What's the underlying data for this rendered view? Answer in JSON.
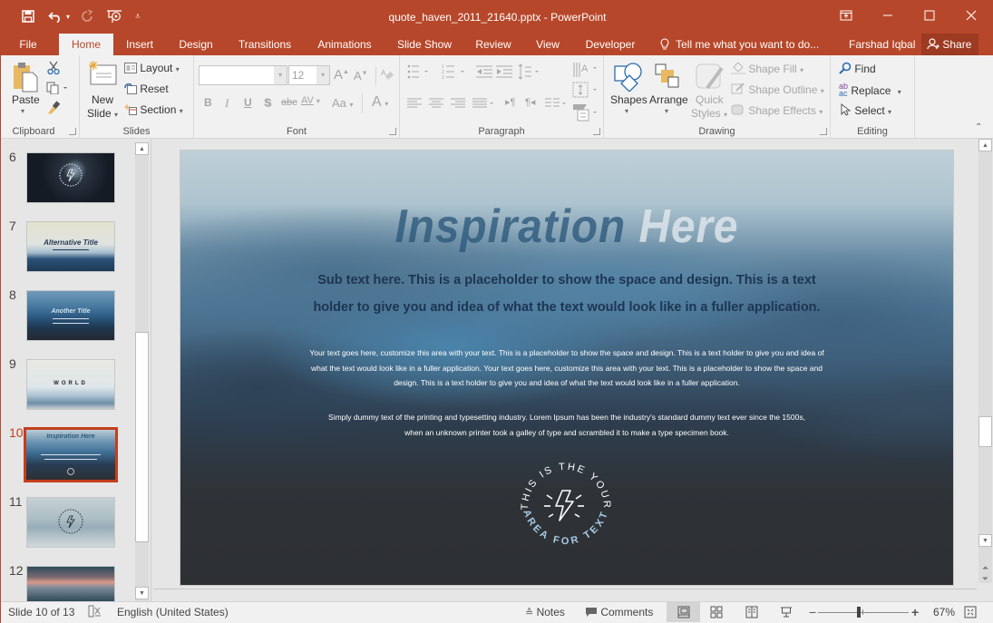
{
  "window": {
    "title": "quote_haven_2011_21640.pptx - PowerPoint",
    "controls": [
      "ribbon-display-options",
      "minimize",
      "maximize",
      "close"
    ]
  },
  "qat": {
    "icons": [
      "save-icon",
      "undo-icon",
      "undo-dropdown-icon",
      "redo-icon",
      "start-from-beginning-icon",
      "customize-qat-icon"
    ]
  },
  "tabs": [
    {
      "label": "File"
    },
    {
      "label": "Home",
      "active": true
    },
    {
      "label": "Insert"
    },
    {
      "label": "Design"
    },
    {
      "label": "Transitions"
    },
    {
      "label": "Animations"
    },
    {
      "label": "Slide Show"
    },
    {
      "label": "Review"
    },
    {
      "label": "View"
    },
    {
      "label": "Developer"
    }
  ],
  "tellme": {
    "placeholder": "Tell me what you want to do..."
  },
  "user": {
    "name": "Farshad Iqbal",
    "share_label": "Share"
  },
  "ribbon": {
    "clipboard": {
      "label": "Clipboard",
      "paste": "Paste"
    },
    "slides": {
      "label": "Slides",
      "new_slide_1": "New",
      "new_slide_2": "Slide",
      "layout": "Layout",
      "reset": "Reset",
      "section": "Section"
    },
    "font": {
      "label": "Font",
      "font_name": "",
      "font_size": "12",
      "bold": "B",
      "italic": "I",
      "underline": "U",
      "shadow": "S",
      "strikethrough": "abc",
      "spacing": "AV",
      "case": "Aa",
      "color": "A",
      "grow": "A",
      "shrink": "A"
    },
    "paragraph": {
      "label": "Paragraph"
    },
    "drawing": {
      "label": "Drawing",
      "shapes": "Shapes",
      "arrange": "Arrange",
      "quick_styles_1": "Quick",
      "quick_styles_2": "Styles",
      "shape_fill": "Shape Fill",
      "shape_outline": "Shape Outline",
      "shape_effects": "Shape Effects"
    },
    "editing": {
      "label": "Editing",
      "find": "Find",
      "replace": "Replace",
      "select": "Select"
    }
  },
  "thumbnails": [
    {
      "number": "6",
      "title": "",
      "selected": false
    },
    {
      "number": "7",
      "title": "Alternative Title",
      "selected": false
    },
    {
      "number": "8",
      "title": "Another Title",
      "selected": false
    },
    {
      "number": "9",
      "title": "WORLD",
      "selected": false
    },
    {
      "number": "10",
      "title": "Inspiration Here",
      "selected": true
    },
    {
      "number": "11",
      "title": "",
      "selected": false
    },
    {
      "number": "12",
      "title": "",
      "selected": false
    }
  ],
  "slide": {
    "title_part1": "Inspiration",
    "title_part2": "Here",
    "subtitle": "Sub text here. This is a placeholder to show the space and design. This is a text holder to give you and idea of what the text would look like in a fuller application.",
    "body1": "Your text goes here, customize this area with your text. This is a placeholder to show the space and design. This is a text holder to give you and idea of what the text would look like in a fuller application. Your text goes here, customize this area with your text. This is a placeholder to show the space and design. This is a text holder to give you and idea of what the text would look like in a fuller application.",
    "body2": "Simply dummy text of the printing and typesetting industry. Lorem Ipsum has been the industry's standard dummy text ever since the 1500s, when an unknown printer took a galley of type and scrambled it to make a type specimen book.",
    "badge_top": "THIS IS THE YOUR",
    "badge_bottom": "AREA FOR TEXT",
    "colors": {
      "accent": "#b7472a",
      "badge_bottom": "#a9cbe6",
      "subtitle": "#1d3552"
    }
  },
  "status": {
    "slide_info": "Slide 10 of 13",
    "language": "English (United States)",
    "notes": "Notes",
    "comments": "Comments",
    "zoom": "67%",
    "zoom_fraction": 0.45
  }
}
